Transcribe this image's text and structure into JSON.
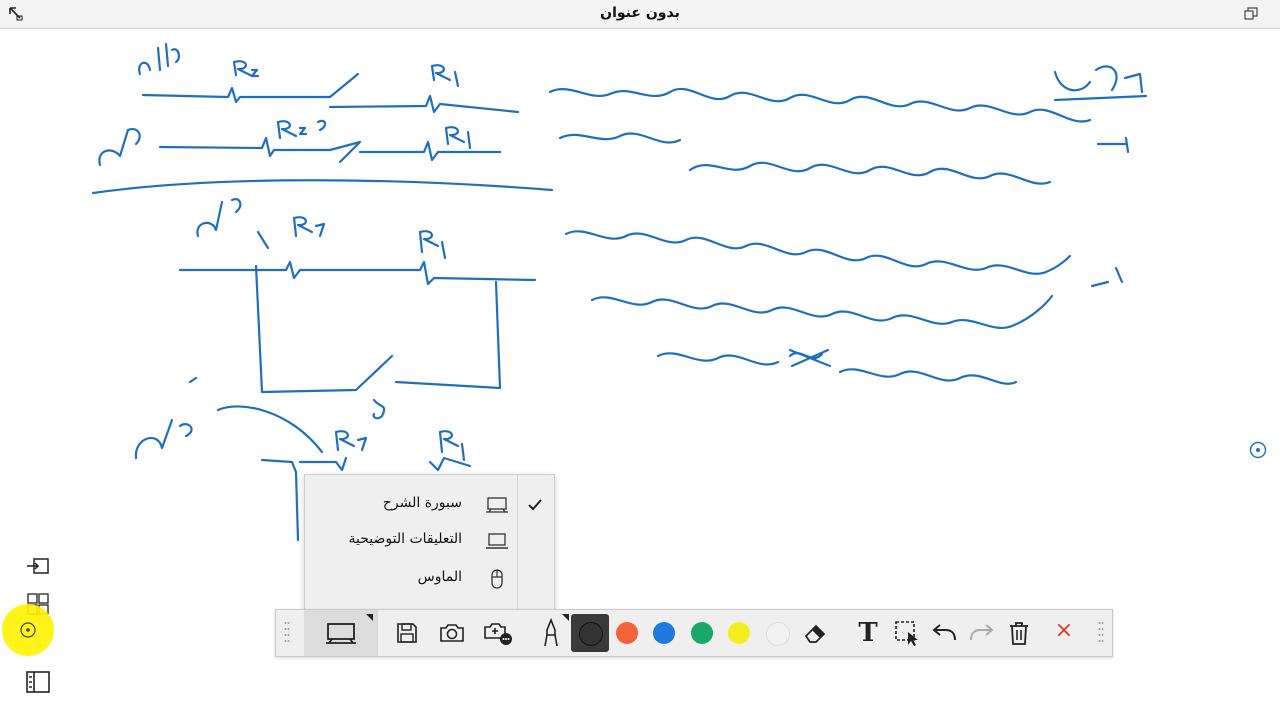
{
  "window": {
    "title": "بدون عنوان"
  },
  "menu": {
    "items": [
      {
        "label": "سبورة الشرح",
        "icon": "board-icon",
        "checked": true
      },
      {
        "label": "التعليقات التوضيحية",
        "icon": "laptop-icon",
        "checked": false
      },
      {
        "label": "الماوس",
        "icon": "mouse-icon",
        "checked": false
      }
    ]
  },
  "toolbar": {
    "tools": [
      "board-mode-icon",
      "save-icon",
      "camera-icon",
      "screen-record-icon",
      "pen-icon"
    ],
    "colors": [
      "#333333",
      "#f4623a",
      "#1f7ae0",
      "#1aa86a",
      "#f2ef1c",
      "#f2f2f2"
    ],
    "active_color": "#333333",
    "text_tool_label": "T",
    "close_label": "×"
  },
  "side_tools": [
    "insert-page-icon",
    "grid-page-icon",
    "page-list-icon"
  ],
  "accent": "#1a73b8"
}
